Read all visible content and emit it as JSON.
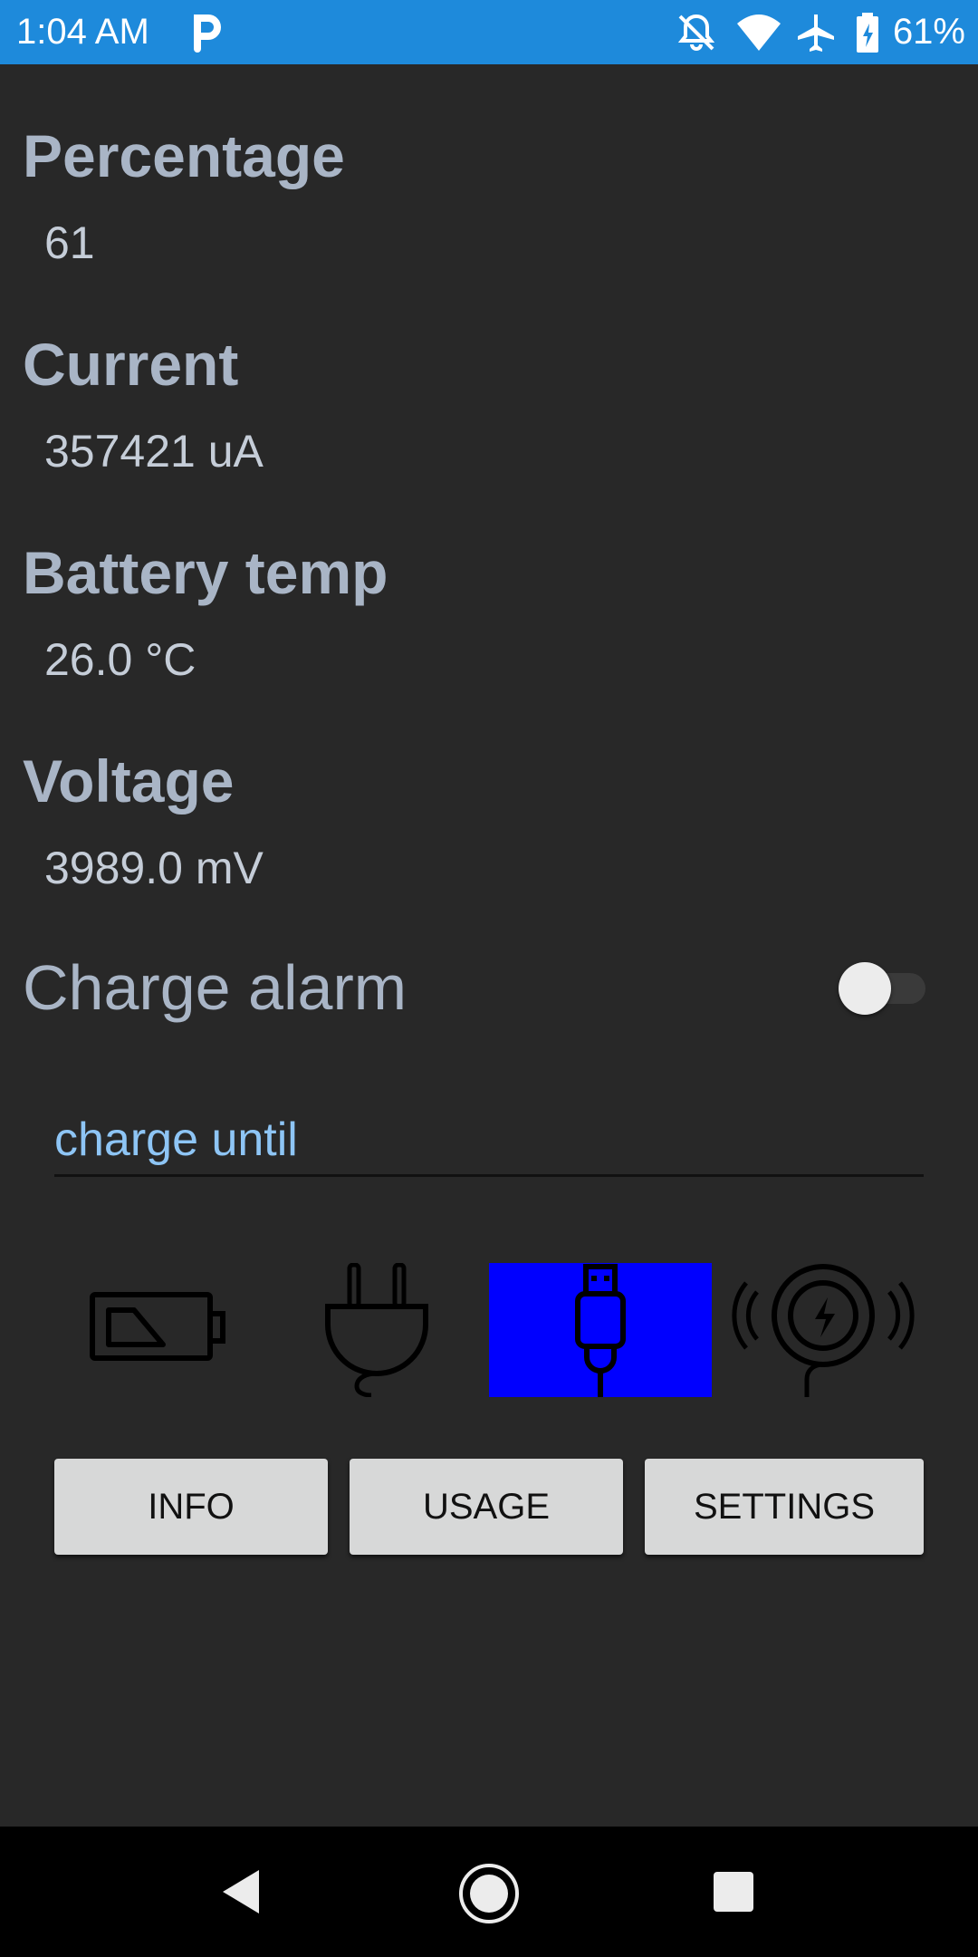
{
  "status_bar": {
    "time": "1:04 AM",
    "battery_percent": "61%",
    "icons": [
      "p-icon",
      "notifications-off-icon",
      "wifi-icon",
      "airplane-icon",
      "battery-charging-icon"
    ],
    "color": "#1E8ADB"
  },
  "metrics": [
    {
      "label": "Percentage",
      "value": "61"
    },
    {
      "label": "Current",
      "value": "357421 uA"
    },
    {
      "label": "Battery temp",
      "value": "26.0 °C"
    },
    {
      "label": "Voltage",
      "value": "3989.0 mV"
    }
  ],
  "charge_alarm": {
    "label": "Charge alarm",
    "enabled": false
  },
  "charge_until": {
    "placeholder": "charge until",
    "value": ""
  },
  "charge_modes": [
    {
      "icon": "battery-icon",
      "selected": false
    },
    {
      "icon": "ac-plug-icon",
      "selected": false
    },
    {
      "icon": "usb-icon",
      "selected": true
    },
    {
      "icon": "wireless-charging-icon",
      "selected": false
    }
  ],
  "buttons": {
    "info": "INFO",
    "usage": "USAGE",
    "settings": "SETTINGS"
  },
  "nav_bar": {
    "icons": [
      "back-icon",
      "home-icon",
      "recents-icon"
    ]
  }
}
